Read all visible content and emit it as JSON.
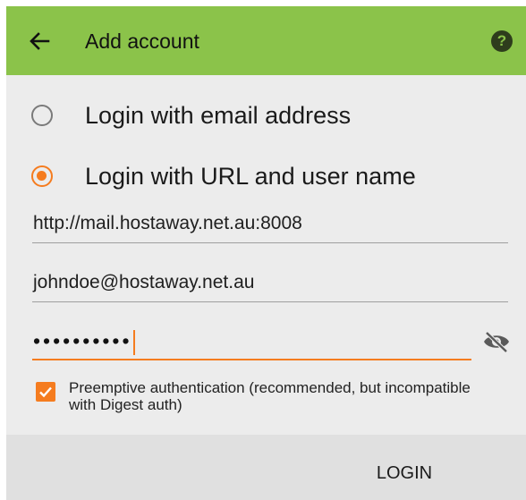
{
  "toolbar": {
    "title": "Add account",
    "back_icon": "arrow-left-icon",
    "help_icon": "help-circle-icon",
    "help_glyph": "?",
    "background_color": "#8bc34a"
  },
  "login_options": [
    {
      "label": "Login with email address",
      "selected": false
    },
    {
      "label": "Login with URL and user name",
      "selected": true
    }
  ],
  "fields": {
    "url": {
      "value": "http://mail.hostaway.net.au:8008"
    },
    "username": {
      "value": "johndoe@hostaway.net.au"
    },
    "password": {
      "masked_value": "••••••••••",
      "focused": true,
      "visibility_icon": "eye-off-icon"
    }
  },
  "preemptive_auth": {
    "checked": true,
    "label": "Preemptive authentication (recommended, but incompatible with Digest auth)"
  },
  "actions": {
    "login_label": "LOGIN"
  },
  "colors": {
    "accent": "#f57c1f",
    "bottom_bar": "#e0e0e0",
    "page_background": "#ececec"
  }
}
